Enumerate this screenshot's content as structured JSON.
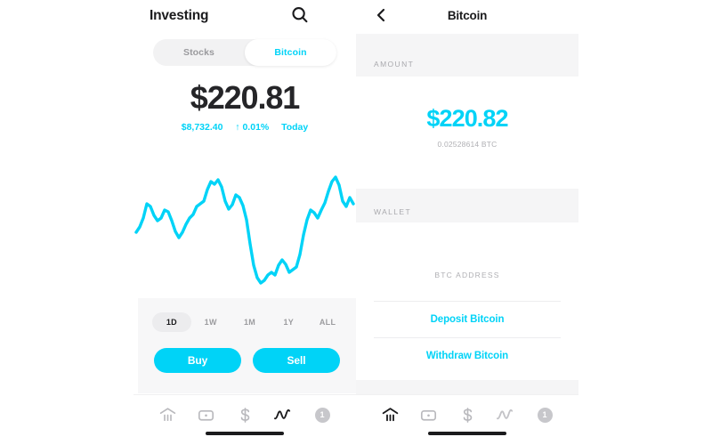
{
  "colors": {
    "accent": "#00d3f7",
    "text_dark": "#252528",
    "text_muted": "#9a9a9d",
    "band_gray": "#f5f5f6",
    "panel_gray": "#f7f7f8"
  },
  "left_screen": {
    "nav": {
      "title": "Investing",
      "search_icon": "search-icon"
    },
    "segmented": {
      "options": [
        {
          "label": "Stocks",
          "active": false
        },
        {
          "label": "Bitcoin",
          "active": true
        }
      ]
    },
    "price": {
      "value": "$220.81",
      "reference": "$8,732.40",
      "change_arrow": "↑",
      "change_percent": "0.01%",
      "period": "Today"
    },
    "ranges": [
      {
        "label": "1D",
        "active": true
      },
      {
        "label": "1W",
        "active": false
      },
      {
        "label": "1M",
        "active": false
      },
      {
        "label": "1Y",
        "active": false
      },
      {
        "label": "ALL",
        "active": false
      }
    ],
    "actions": {
      "buy_label": "Buy",
      "sell_label": "Sell"
    },
    "tabbar": {
      "items": [
        {
          "icon": "bank-icon",
          "active": false
        },
        {
          "icon": "card-icon",
          "active": false
        },
        {
          "icon": "dollar-icon",
          "active": false
        },
        {
          "icon": "activity-icon",
          "active": true
        },
        {
          "icon": "profile-badge-icon",
          "badge": "1",
          "active": false
        }
      ]
    }
  },
  "right_screen": {
    "nav": {
      "back_icon": "chevron-left-icon",
      "title": "Bitcoin"
    },
    "amount_section": {
      "header": "AMOUNT",
      "value": "$220.82",
      "crypto_value": "0.02528614 BTC"
    },
    "wallet_section": {
      "header": "WALLET",
      "address_label": "BTC ADDRESS",
      "links": [
        {
          "label": "Deposit Bitcoin"
        },
        {
          "label": "Withdraw Bitcoin"
        }
      ]
    },
    "tabbar": {
      "items": [
        {
          "icon": "bank-icon",
          "active": true
        },
        {
          "icon": "card-icon",
          "active": false
        },
        {
          "icon": "dollar-icon",
          "active": false
        },
        {
          "icon": "activity-icon",
          "active": false
        },
        {
          "icon": "profile-badge-icon",
          "badge": "1",
          "active": false
        }
      ]
    }
  },
  "chart_data": {
    "type": "line",
    "title": "",
    "xlabel": "",
    "ylabel": "",
    "grid": false,
    "legend": null,
    "line_color": "#00d3f7",
    "x": [
      0,
      2,
      4,
      6,
      8,
      10,
      12,
      14,
      16,
      18,
      20,
      22,
      24,
      26,
      28,
      30,
      32,
      34,
      36,
      38,
      40,
      42,
      44,
      46,
      48,
      50,
      52,
      54,
      56,
      58,
      60,
      62,
      64,
      66,
      68,
      70,
      72,
      74,
      76,
      78,
      80,
      82,
      84,
      86,
      88,
      90,
      92,
      94,
      96,
      98,
      100
    ],
    "values": [
      52,
      54,
      60,
      76,
      74,
      66,
      62,
      64,
      70,
      69,
      62,
      54,
      48,
      52,
      58,
      63,
      66,
      72,
      74,
      76,
      86,
      92,
      90,
      94,
      88,
      76,
      70,
      74,
      82,
      80,
      74,
      62,
      44,
      26,
      16,
      12,
      14,
      18,
      20,
      18,
      26,
      30,
      26,
      20,
      22,
      24,
      34,
      50,
      62,
      70,
      68,
      64,
      70,
      76,
      84,
      92,
      96,
      90,
      78,
      74,
      80,
      76,
      70
    ],
    "ylim": [
      0,
      100
    ],
    "xlim": [
      0,
      100
    ]
  }
}
